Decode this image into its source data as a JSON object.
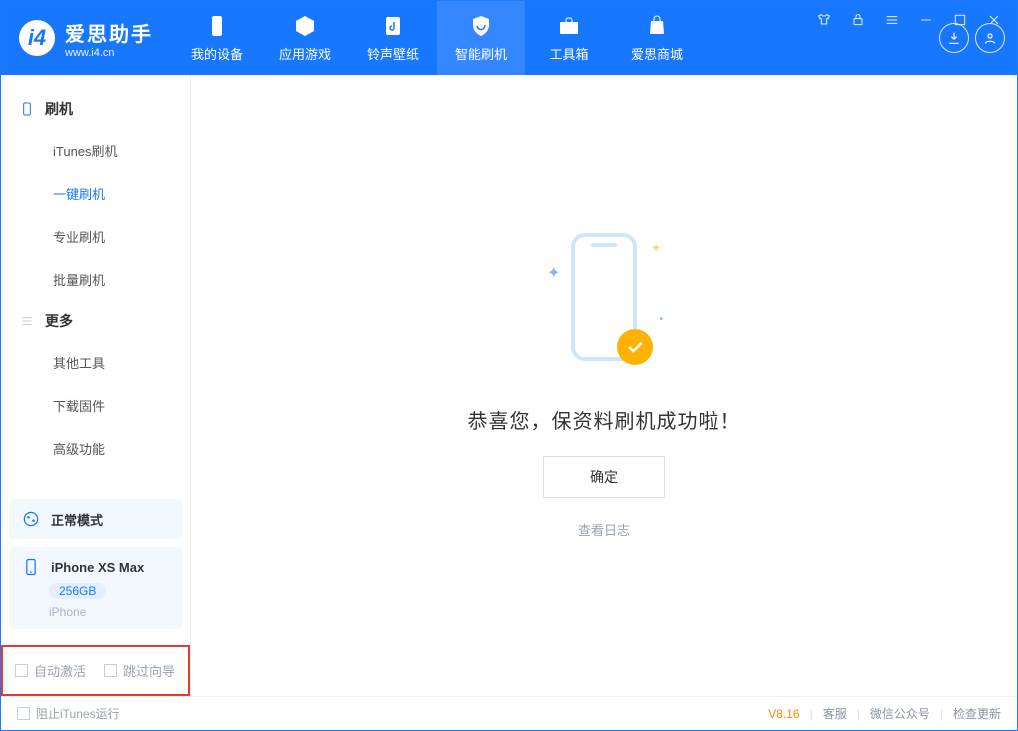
{
  "app": {
    "name_cn": "爱思助手",
    "name_en": "www.i4.cn"
  },
  "nav": {
    "items": [
      {
        "label": "我的设备"
      },
      {
        "label": "应用游戏"
      },
      {
        "label": "铃声壁纸"
      },
      {
        "label": "智能刷机"
      },
      {
        "label": "工具箱"
      },
      {
        "label": "爱思商城"
      }
    ]
  },
  "sidebar": {
    "group1": {
      "title": "刷机",
      "items": [
        "iTunes刷机",
        "一键刷机",
        "专业刷机",
        "批量刷机"
      ]
    },
    "group2": {
      "title": "更多",
      "items": [
        "其他工具",
        "下载固件",
        "高级功能"
      ]
    }
  },
  "mode_card": {
    "label": "正常模式"
  },
  "device_card": {
    "name": "iPhone XS Max",
    "storage": "256GB",
    "type": "iPhone"
  },
  "redbox": {
    "opt1": "自动激活",
    "opt2": "跳过向导"
  },
  "main": {
    "success_msg": "恭喜您，保资料刷机成功啦！",
    "ok_btn": "确定",
    "view_log": "查看日志"
  },
  "status": {
    "block_itunes": "阻止iTunes运行",
    "version": "V8.16",
    "links": [
      "客服",
      "微信公众号",
      "检查更新"
    ]
  }
}
